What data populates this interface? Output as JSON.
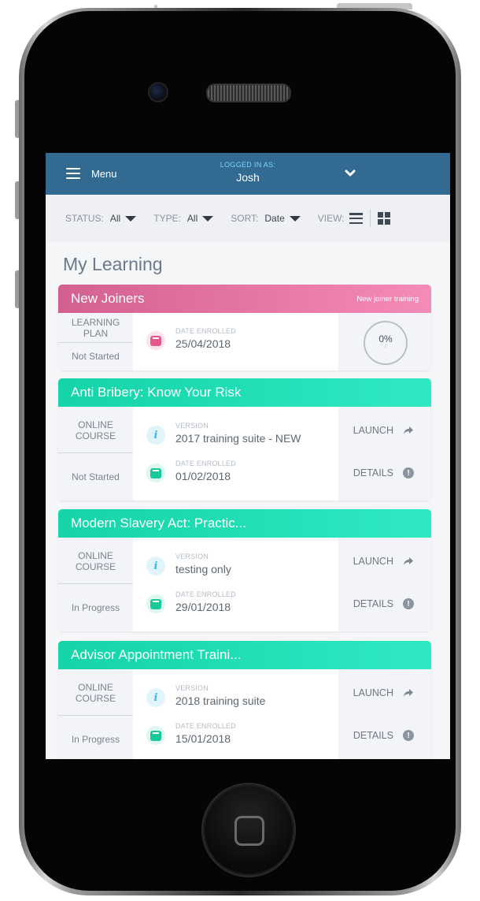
{
  "app": {
    "menu_label": "Menu",
    "logged_in_label": "LOGGED IN AS:",
    "user_name": "Josh"
  },
  "filters": {
    "status_label": "STATUS:",
    "status_value": "All",
    "type_label": "TYPE:",
    "type_value": "All",
    "sort_label": "SORT:",
    "sort_value": "Date",
    "view_label": "VIEW:"
  },
  "page_title": "My Learning",
  "colors": {
    "topbar": "#336a92",
    "pink_accent": "#e5588f",
    "teal_accent": "#19d6aa"
  },
  "cards": [
    {
      "title": "New Joiners",
      "tag": "New joiner training",
      "type": "LEARNING PLAN",
      "status": "Not Started",
      "date_caption": "DATE ENROLLED",
      "date": "25/04/2018",
      "progress_text": "0%",
      "progress_tick": "/",
      "progress": 0
    },
    {
      "title": "Anti Bribery: Know Your Risk",
      "type": "ONLINE COURSE",
      "status": "Not Started",
      "version_caption": "VERSION",
      "version": "2017 training suite - NEW",
      "date_caption": "DATE ENROLLED",
      "date": "01/02/2018",
      "launch_label": "LAUNCH",
      "details_label": "DETAILS"
    },
    {
      "title": "Modern Slavery Act: Practic...",
      "type": "ONLINE COURSE",
      "status": "In Progress",
      "version_caption": "VERSION",
      "version": "testing only",
      "date_caption": "DATE ENROLLED",
      "date": "29/01/2018",
      "launch_label": "LAUNCH",
      "details_label": "DETAILS"
    },
    {
      "title": "Advisor Appointment Traini...",
      "type": "ONLINE COURSE",
      "status": "In Progress",
      "version_caption": "VERSION",
      "version": "2018 training suite",
      "date_caption": "DATE ENROLLED",
      "date": "15/01/2018",
      "launch_label": "LAUNCH",
      "details_label": "DETAILS"
    }
  ],
  "icons": {
    "hamburger": "hamburger-icon",
    "chevron": "chevron-down-icon",
    "list_view": "list-view-icon",
    "grid_view": "grid-view-icon",
    "calendar": "calendar-icon",
    "info": "info-icon",
    "launch": "share-arrow-icon",
    "details": "question-icon"
  }
}
